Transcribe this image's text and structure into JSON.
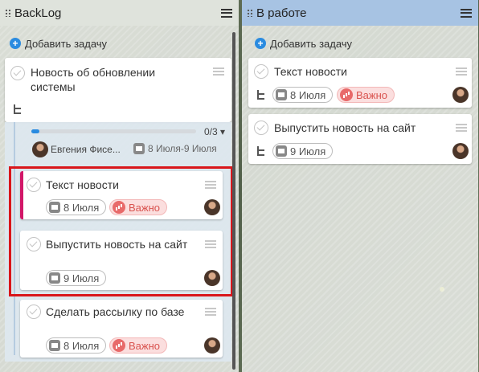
{
  "columns": [
    {
      "title": "BackLog",
      "add_label": "Добавить задачу",
      "parent_card": {
        "title_line1": "Новость об обновлении",
        "title_line2": "системы",
        "progress_text": "0/3",
        "progress_fraction": 0.05,
        "assignee": "Евгения Фисе...",
        "date_range": "8 Июля-9 Июля"
      },
      "subtasks": [
        {
          "title": "Текст новости",
          "date": "8 Июля",
          "badge": "Важно"
        },
        {
          "title": "Выпустить новость на сайт",
          "date": "9 Июля"
        },
        {
          "title": "Сделать рассылку по базе",
          "date": "8 Июля",
          "badge": "Важно"
        }
      ]
    },
    {
      "title": "В работе",
      "add_label": "Добавить задачу",
      "cards": [
        {
          "title": "Текст новости",
          "date": "8 Июля",
          "badge": "Важно"
        },
        {
          "title": "Выпустить новость на сайт",
          "date": "9 Июля"
        }
      ]
    }
  ],
  "colors": {
    "accent_blue": "#2a8be0",
    "important_red": "#d9534f",
    "highlight_red": "#d9161b",
    "stripe_magenta": "#d21768",
    "right_header": "#a7c3e3"
  }
}
